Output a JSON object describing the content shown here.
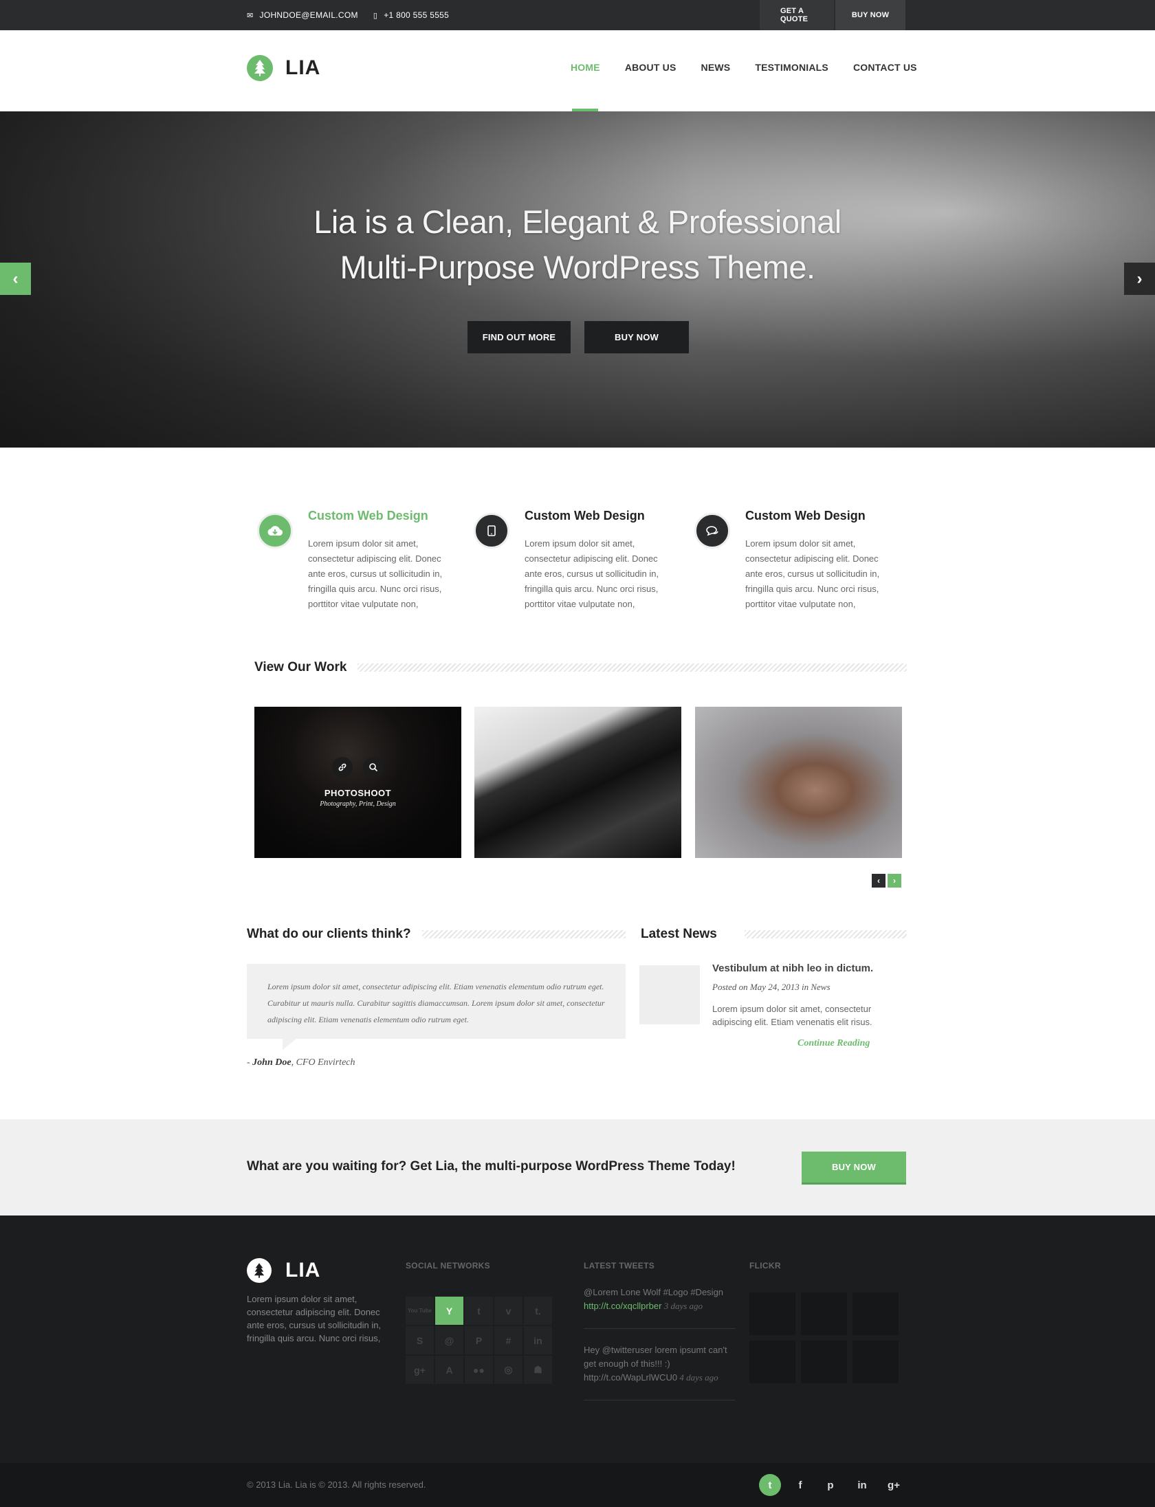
{
  "topbar": {
    "email": "JOHNDOE@EMAIL.COM",
    "phone": "+1 800 555 5555",
    "quote_label": "GET A QUOTE",
    "buy_label": "BUY NOW"
  },
  "header": {
    "logo_text": "LIA",
    "nav": [
      "HOME",
      "ABOUT US",
      "NEWS",
      "TESTIMONIALS",
      "CONTACT US"
    ],
    "active_nav": "HOME"
  },
  "hero": {
    "headline_line1": "Lia is a Clean, Elegant & Professional",
    "headline_line2": "Multi-Purpose WordPress Theme.",
    "find_label": "FIND OUT MORE",
    "buy_label": "BUY NOW"
  },
  "features": [
    {
      "title": "Custom Web Design",
      "icon": "cloud-download-icon",
      "text": "Lorem ipsum dolor sit amet, consectetur adipiscing elit. Donec ante eros, cursus ut sollicitudin in, fringilla quis arcu. Nunc orci risus, porttitor vitae vulputate non,"
    },
    {
      "title": "Custom Web Design",
      "icon": "tablet-icon",
      "text": "Lorem ipsum dolor sit amet, consectetur adipiscing elit. Donec ante eros, cursus ut sollicitudin in, fringilla quis arcu. Nunc orci risus, porttitor vitae vulputate non,"
    },
    {
      "title": "Custom Web Design",
      "icon": "chat-icon",
      "text": "Lorem ipsum dolor sit amet, consectetur adipiscing elit. Donec ante eros, cursus ut sollicitudin in, fringilla quis arcu. Nunc orci risus, porttitor vitae vulputate non,"
    }
  ],
  "work": {
    "heading": "View Our Work",
    "item1_title": "PHOTOSHOOT",
    "item1_subtitle": "Photography, Print, Design"
  },
  "testimonials": {
    "heading": "What do our clients think?",
    "quote": "Lorem ipsum dolor sit amet, consectetur adipiscing elit. Etiam venenatis elementum odio rutrum eget. Curabitur ut mauris nulla. Curabitur sagittis diamaccumsan. Lorem ipsum dolor sit amet, consectetur adipiscing elit. Etiam venenatis elementum odio rutrum eget.",
    "author_prefix": "- ",
    "author_name": "John Doe",
    "author_role": ", CFO Envirtech"
  },
  "news": {
    "heading": "Latest News",
    "title": "Vestibulum at nibh leo in dictum.",
    "meta": "Posted on May 24, 2013 in News",
    "text": "Lorem ipsum dolor sit amet, consectetur adipiscing elit. Etiam venenatis elit risus.",
    "more": "Continue Reading"
  },
  "cta": {
    "text": "What are you waiting for? Get Lia, the multi-purpose WordPress Theme Today!",
    "button": "BUY NOW"
  },
  "footer": {
    "logo_text": "LIA",
    "about": "Lorem ipsum dolor sit amet, consectetur adipiscing elit. Donec ante eros, cursus ut sollicitudin in, fringilla quis arcu. Nunc orci risus,",
    "social_heading": "SOCIAL NETWORKS",
    "social_icons": [
      "You Tube",
      "Y",
      "t",
      "v",
      "t.",
      "S",
      "@",
      "P",
      "#",
      "in",
      "g+",
      "A",
      "●●",
      "◎",
      "☗"
    ],
    "social_names": [
      "youtube-icon",
      "yahoo-icon",
      "tumblr-icon",
      "vimeo-icon",
      "tumblr-alt-icon",
      "skype-icon",
      "reddit-icon",
      "pinterest-icon",
      "myspace-icon",
      "linkedin-icon",
      "google-plus-icon",
      "aim-icon",
      "flickr-icon",
      "dribbble-icon",
      "friends-icon"
    ],
    "social_active_index": 1,
    "tweets_heading": "LATEST TWEETS",
    "tweet1_text": "@Lorem Lone Wolf #Logo #Design",
    "tweet1_link": "http://t.co/xqcllprber",
    "tweet1_time": " 3 days ago",
    "tweet2_text": "Hey @twitteruser lorem ipsumt can't get enough of this!!! :)",
    "tweet2_link": "http://t.co/WapLrlWCU0",
    "tweet2_time": " 4 days ago",
    "flickr_heading": "FLICKR"
  },
  "bottombar": {
    "copyright": "© 2013 Lia. Lia is © 2013. All rights reserved.",
    "social": [
      "twitter-icon",
      "facebook-icon",
      "pinterest-icon",
      "linkedin-icon",
      "google-plus-icon"
    ],
    "social_glyphs": [
      "t",
      "f",
      "p",
      "in",
      "g+"
    ]
  },
  "colors": {
    "accent": "#6dbb6d",
    "dark": "#2b2c2e",
    "footer": "#1c1d1f"
  }
}
